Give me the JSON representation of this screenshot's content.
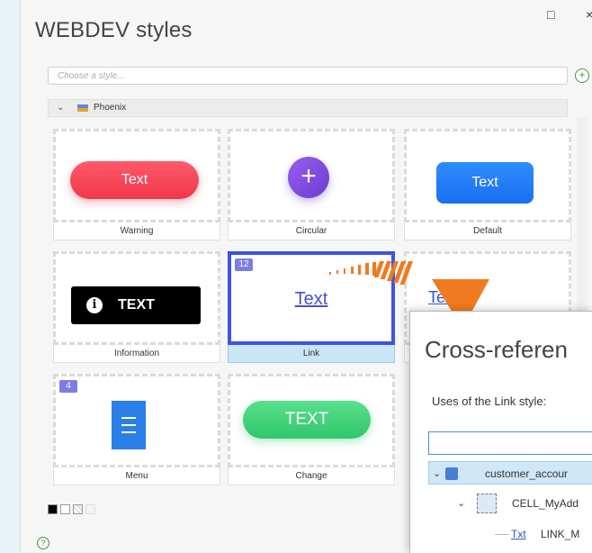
{
  "window": {
    "title": "WEBDEV styles",
    "maximize_glyph": "□",
    "close_glyph": "×"
  },
  "search": {
    "placeholder": "Choose a style..."
  },
  "group": {
    "label": "Phoenix"
  },
  "styles": [
    {
      "name": "Warning",
      "preview_text": "Text",
      "badge": ""
    },
    {
      "name": "Circular",
      "preview_text": "+",
      "badge": ""
    },
    {
      "name": "Default",
      "preview_text": "Text",
      "badge": ""
    },
    {
      "name": "Information",
      "preview_text": "TEXT",
      "badge": ""
    },
    {
      "name": "Link",
      "preview_text": "Text",
      "badge": "12"
    },
    {
      "name": "",
      "preview_text": "Text",
      "badge": ""
    },
    {
      "name": "Menu",
      "preview_text": "",
      "badge": "4"
    },
    {
      "name": "Change",
      "preview_text": "TEXT",
      "badge": ""
    }
  ],
  "colors": {
    "warning": "#f0384a",
    "circular": "#7a4ae0",
    "default": "#1a6ff0",
    "information": "#000000",
    "link": "#4b4fd6",
    "menu": "#2a7fe8",
    "change": "#30c66a",
    "selection": "#3f52e6",
    "arrow": "#f07a1e"
  },
  "help_glyph": "?",
  "add_glyph": "+",
  "crossref": {
    "title": "Cross-referen",
    "uses_label": "Uses of the Link style:",
    "search_value": "",
    "tree": [
      {
        "label": "customer_accour",
        "expanded": true
      },
      {
        "label": "CELL_MyAdd",
        "expanded": true
      },
      {
        "prefix": "Txt",
        "label": "LINK_M"
      }
    ]
  }
}
